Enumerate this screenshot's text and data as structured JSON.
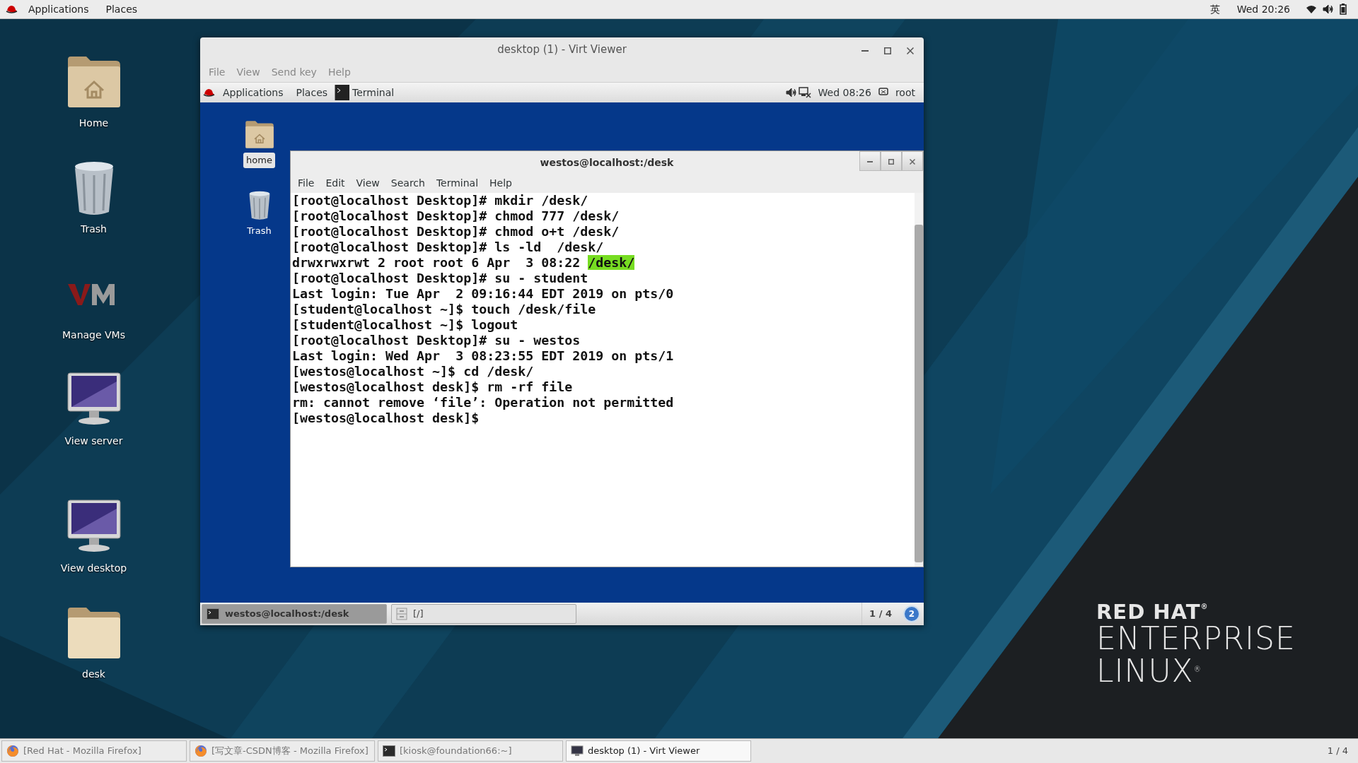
{
  "top_bar": {
    "menus": [
      "Applications",
      "Places"
    ],
    "input_method": "英",
    "clock": "Wed 20:26"
  },
  "desktop_icons": [
    {
      "label": "Home",
      "kind": "home"
    },
    {
      "label": "Trash",
      "kind": "trash"
    },
    {
      "label": "Manage VMs",
      "kind": "vm"
    },
    {
      "label": "View server",
      "kind": "monitor"
    },
    {
      "label": "View desktop",
      "kind": "monitor"
    },
    {
      "label": "desk",
      "kind": "folder"
    }
  ],
  "viewer": {
    "title": "desktop (1) - Virt Viewer",
    "menus": [
      "File",
      "View",
      "Send key",
      "Help"
    ],
    "guest": {
      "panel": {
        "menus": [
          "Applications",
          "Places"
        ],
        "task": "Terminal",
        "clock": "Wed 08:26",
        "user": "root"
      },
      "desktop_icons": [
        {
          "label": "home",
          "kind": "home",
          "selected": true
        },
        {
          "label": "Trash",
          "kind": "trash",
          "selected": false
        }
      ],
      "terminal": {
        "title": "westos@localhost:/desk",
        "menus": [
          "File",
          "Edit",
          "View",
          "Search",
          "Terminal",
          "Help"
        ],
        "lines": [
          {
            "text": "[root@localhost Desktop]# mkdir /desk/"
          },
          {
            "text": "[root@localhost Desktop]# chmod 777 /desk/"
          },
          {
            "text": "[root@localhost Desktop]# chmod o+t /desk/"
          },
          {
            "text": "[root@localhost Desktop]# ls -ld  /desk/"
          },
          {
            "text": "drwxrwxrwt 2 root root 6 Apr  3 08:22 ",
            "highlight": "/desk/"
          },
          {
            "text": "[root@localhost Desktop]# su - student"
          },
          {
            "text": "Last login: Tue Apr  2 09:16:44 EDT 2019 on pts/0"
          },
          {
            "text": "[student@localhost ~]$ touch /desk/file"
          },
          {
            "text": "[student@localhost ~]$ logout"
          },
          {
            "text": "[root@localhost Desktop]# su - westos"
          },
          {
            "text": "Last login: Wed Apr  3 08:23:55 EDT 2019 on pts/1"
          },
          {
            "text": "[westos@localhost ~]$ cd /desk/"
          },
          {
            "text": "[westos@localhost desk]$ rm -rf file"
          },
          {
            "text": "rm: cannot remove ‘file’: Operation not permitted"
          },
          {
            "text": "[westos@localhost desk]$"
          }
        ]
      },
      "taskbar": {
        "tasks": [
          {
            "label": "westos@localhost:/desk",
            "kind": "terminal",
            "selected": true
          },
          {
            "label": "[/]",
            "kind": "files",
            "selected": false
          }
        ],
        "workspace": "1 / 4",
        "notification_count": "2"
      }
    }
  },
  "wallpaper_logo": {
    "line_1": "RED HAT$^{®}$",
    "line_2": "ENTERPRISE",
    "line_3": "LINUX$^{®}$"
  },
  "taskbar": {
    "tasks": [
      {
        "label": "[Red Hat - Mozilla Firefox]",
        "kind": "firefox",
        "selected": false
      },
      {
        "label": "[写文章-CSDN博客 - Mozilla Firefox]",
        "kind": "firefox",
        "selected": false
      },
      {
        "label": "[kiosk@foundation66:~]",
        "kind": "terminal",
        "selected": false
      },
      {
        "label": "desktop (1) - Virt Viewer",
        "kind": "viewer",
        "selected": true
      }
    ],
    "workspace": "1 / 4"
  }
}
